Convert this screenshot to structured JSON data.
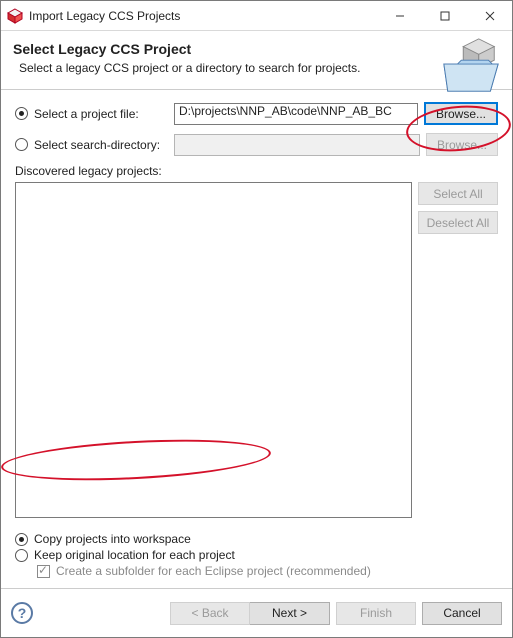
{
  "window": {
    "title": "Import Legacy CCS Projects"
  },
  "header": {
    "title": "Select Legacy CCS Project",
    "desc": "Select a legacy CCS project or a directory to search for projects."
  },
  "mode": {
    "project_file_label": "Select a project file:",
    "search_dir_label": "Select search-directory:",
    "project_file_value": "D:\\projects\\NNP_AB\\code\\NNP_AB_BC",
    "search_dir_value": "",
    "browse_label": "Browse..."
  },
  "discovered": {
    "label": "Discovered legacy projects:",
    "select_all": "Select All",
    "deselect_all": "Deselect All"
  },
  "options": {
    "copy_label": "Copy projects into workspace",
    "keep_label": "Keep original location for each project",
    "subfolder_label": "Create a subfolder for each Eclipse project (recommended)"
  },
  "footer": {
    "back": "< Back",
    "next": "Next >",
    "finish": "Finish",
    "cancel": "Cancel"
  }
}
